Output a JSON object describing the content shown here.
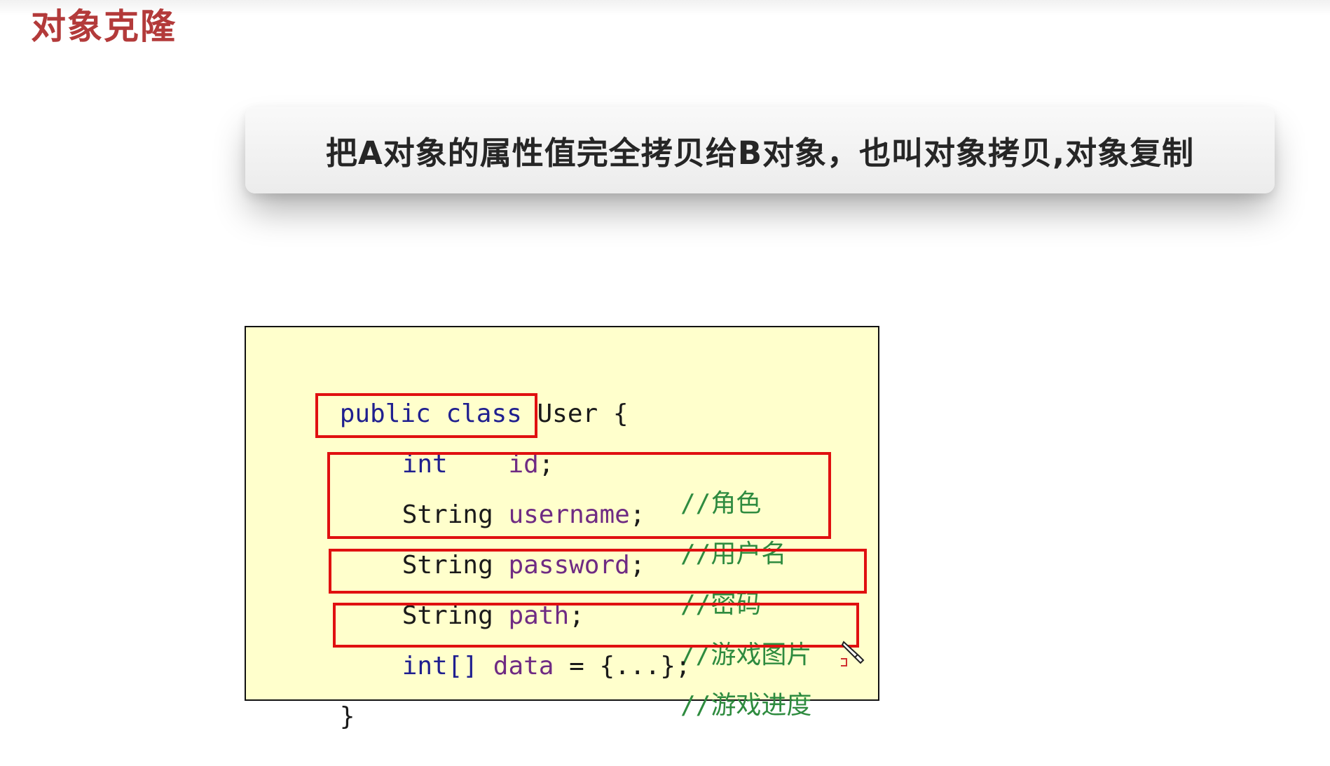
{
  "slide": {
    "title": "对象克隆",
    "definition": "把A对象的属性值完全拷贝给B对象，也叫对象拷贝,对象复制"
  },
  "code": {
    "class_decl": {
      "kw1": "public",
      "kw2": "class",
      "name": "User",
      "brace": "{"
    },
    "fields": [
      {
        "type": "int",
        "name": "id",
        "semi": ";",
        "comment_prefix": "//",
        "comment": "角色"
      },
      {
        "type": "String",
        "name": "username",
        "semi": ";",
        "comment_prefix": "//",
        "comment": "用户名"
      },
      {
        "type": "String",
        "name": "password",
        "semi": ";",
        "comment_prefix": "//",
        "comment": "密码"
      },
      {
        "type": "String",
        "name": "path",
        "semi": ";",
        "comment_prefix": "//",
        "comment": "游戏图片"
      },
      {
        "type": "int[]",
        "name": "data",
        "assign": "=",
        "value": "{...};",
        "comment_prefix": "//",
        "comment": "游戏进度"
      }
    ],
    "closing_brace": "}"
  },
  "colors": {
    "title": "#b33a3a",
    "highlight_border": "#e01010",
    "code_background": "#ffffcc",
    "keyword": "#1f1f8f",
    "identifier": "#6f2b83",
    "comment": "#2e8b3f"
  },
  "icons": {
    "cursor": "pencil-cursor-icon"
  }
}
